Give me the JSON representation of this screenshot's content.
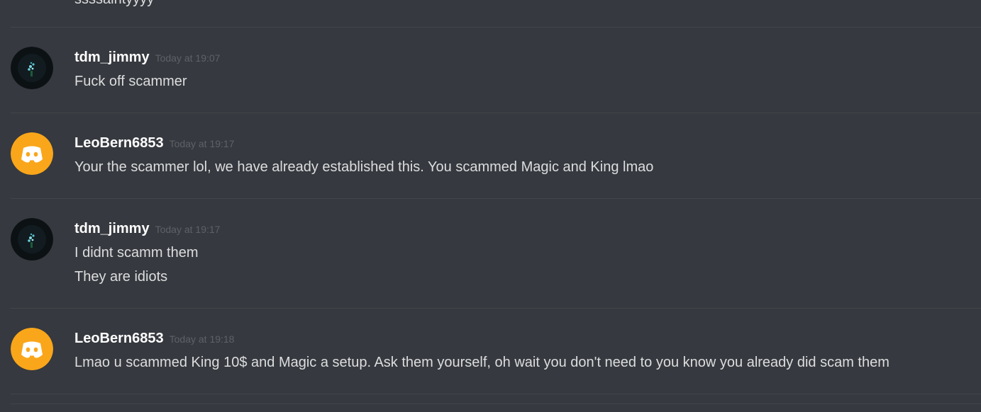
{
  "top_cut_text": "ssssaintyyyy",
  "messages": [
    {
      "username": "tdm_jimmy",
      "timestamp": "Today at 19:07",
      "avatar": "dark-avatar-icon",
      "lines": [
        "Fuck off scammer"
      ]
    },
    {
      "username": "LeoBern6853",
      "timestamp": "Today at 19:17",
      "avatar": "discord-default-avatar-icon",
      "lines": [
        "Your the scammer lol, we have already established this. You scammed Magic and King lmao"
      ]
    },
    {
      "username": "tdm_jimmy",
      "timestamp": "Today at 19:17",
      "avatar": "dark-avatar-icon",
      "lines": [
        "I didnt scamm them",
        "They are idiots"
      ]
    },
    {
      "username": "LeoBern6853",
      "timestamp": "Today at 19:18",
      "avatar": "discord-default-avatar-icon",
      "lines": [
        "Lmao u scammed King 10$ and Magic a setup. Ask them yourself, oh wait you don't need to you know you already did scam them"
      ]
    }
  ],
  "colors": {
    "background": "#36393f",
    "divider": "#42454a",
    "username": "#ffffff",
    "message_text": "#dcddde",
    "timestamp": "#5e6168",
    "discord_avatar": "#faa61a"
  }
}
